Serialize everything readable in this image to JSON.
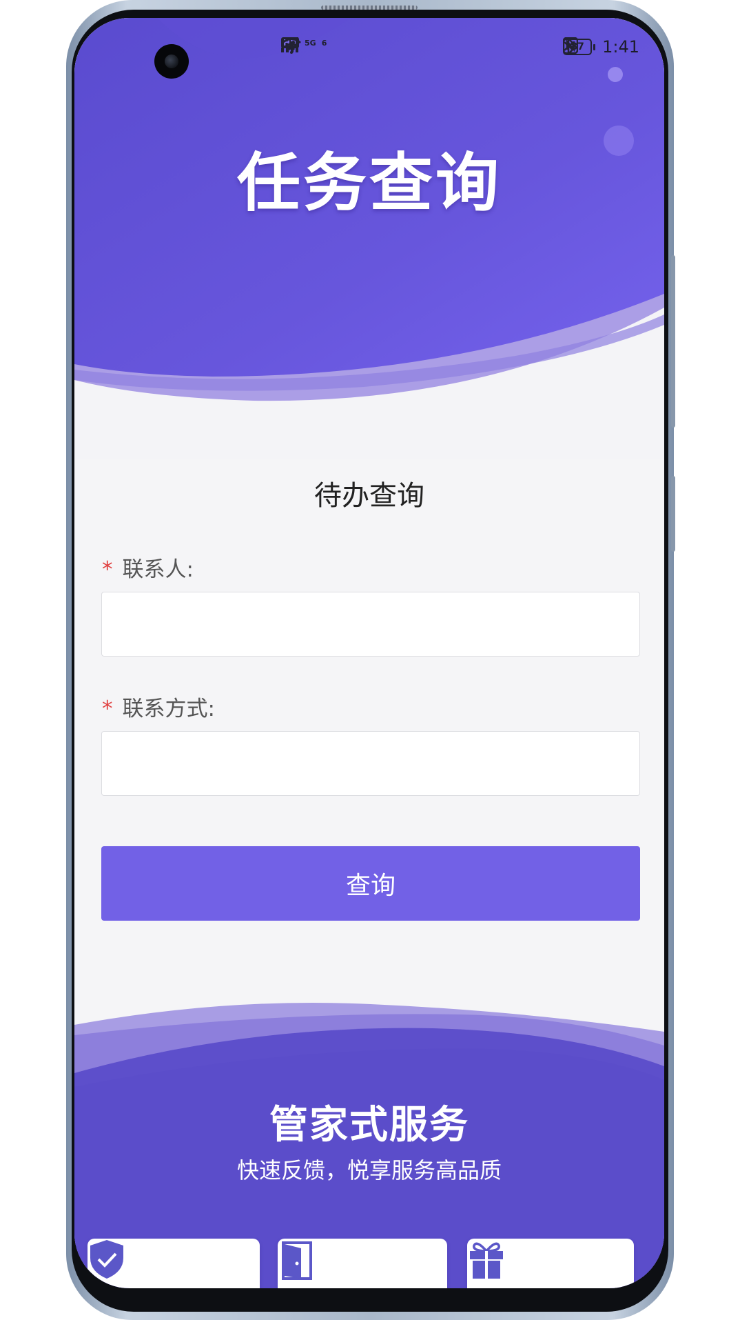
{
  "status_bar": {
    "hd": "HD",
    "network": "5G",
    "wifi_label": "6",
    "battery": "87",
    "time": "1:41",
    "icons": [
      "signal-icon",
      "wifi-icon",
      "nfc-icon",
      "bluetooth-icon",
      "battery-icon"
    ]
  },
  "header": {
    "title": "任务查询"
  },
  "form": {
    "title": "待办查询",
    "required_mark": "*",
    "contact_label": "联系人:",
    "contact_value": "",
    "phone_label": "联系方式:",
    "phone_value": "",
    "submit_label": "查询"
  },
  "footer": {
    "title": "管家式服务",
    "subtitle": "快速反馈，悦享服务高品质",
    "cards": [
      {
        "icon": "shield-check-icon"
      },
      {
        "icon": "door-icon"
      },
      {
        "icon": "gift-icon"
      }
    ]
  },
  "colors": {
    "accent": "#7261e6",
    "header_purple": "#6654d9",
    "required": "#e04040"
  }
}
